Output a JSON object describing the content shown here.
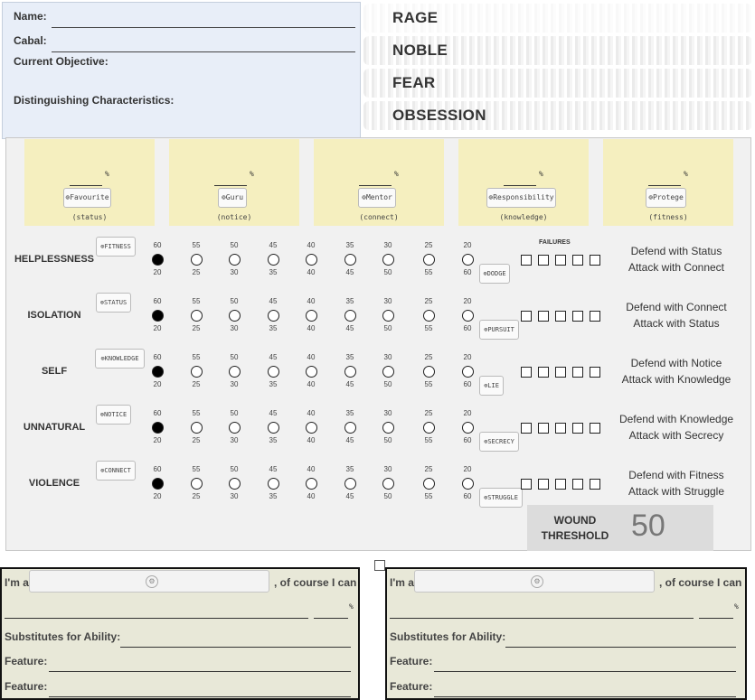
{
  "character": {
    "name_label": "Name:",
    "cabal_label": "Cabal:",
    "objective_label": "Current Objective:",
    "characteristics_label": "Distinguishing Characteristics:"
  },
  "stress": [
    "RAGE",
    "NOBLE",
    "FEAR",
    "OBSESSION"
  ],
  "relationships": [
    {
      "label": "Favourite",
      "sub": "(status)",
      "pct": "%"
    },
    {
      "label": "Guru",
      "sub": "(notice)",
      "pct": "%"
    },
    {
      "label": "Mentor",
      "sub": "(connect)",
      "pct": "%"
    },
    {
      "label": "Responsibility",
      "sub": "(knowledge)",
      "pct": "%"
    },
    {
      "label": "Protege",
      "sub": "(fitness)",
      "pct": "%"
    }
  ],
  "failures_label": "FAILURES",
  "top_numbers": [
    "60",
    "55",
    "50",
    "45",
    "40",
    "35",
    "30",
    "25",
    "20"
  ],
  "bottom_numbers": [
    "20",
    "25",
    "30",
    "35",
    "40",
    "45",
    "50",
    "55",
    "60"
  ],
  "meters": [
    {
      "name": "HELPLESSNESS",
      "tag": "FITNESS",
      "skill": "DODGE",
      "defend": "Defend with Status",
      "attack": "Attack with Connect",
      "filled_index": 0
    },
    {
      "name": "ISOLATION",
      "tag": "STATUS",
      "skill": "PURSUIT",
      "defend": "Defend with Connect",
      "attack": "Attack with Status",
      "filled_index": 0
    },
    {
      "name": "SELF",
      "tag": "KNOWLEDGE",
      "skill": "LIE",
      "defend": "Defend with Notice",
      "attack": "Attack with Knowledge",
      "filled_index": 0
    },
    {
      "name": "UNNATURAL",
      "tag": "NOTICE",
      "skill": "SECRECY",
      "defend": "Defend with Knowledge",
      "attack": "Attack with Secrecy",
      "filled_index": 0
    },
    {
      "name": "VIOLENCE",
      "tag": "CONNECT",
      "skill": "STRUGGLE",
      "defend": "Defend with Fitness",
      "attack": "Attack with Struggle",
      "filled_index": 0
    }
  ],
  "wound": {
    "label_1": "WOUND",
    "label_2": "THRESHOLD",
    "value": "50"
  },
  "identity": {
    "prefix": "I'm a",
    "suffix": ", of course I can",
    "pct": "%",
    "substitutes_label": "Substitutes for Ability:",
    "feature_label": "Feature:"
  }
}
